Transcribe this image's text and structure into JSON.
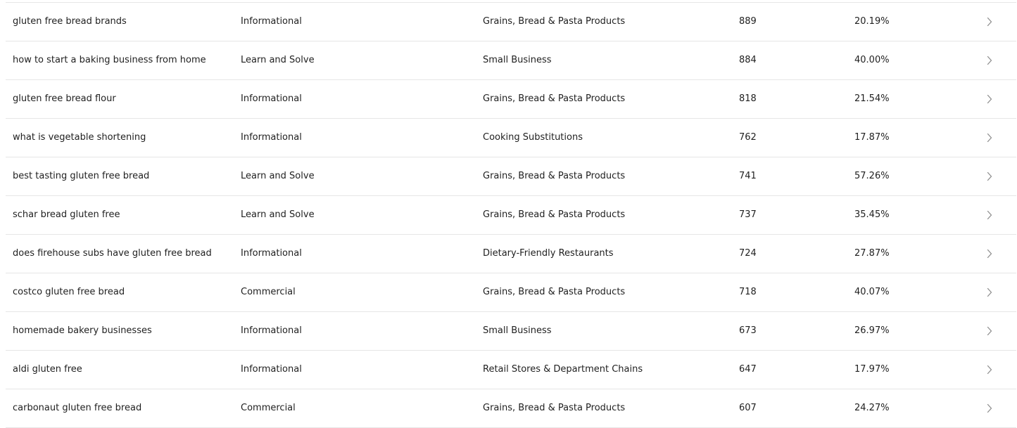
{
  "table": {
    "rows": [
      {
        "keyword": "gluten free bread brands",
        "intent": "Informational",
        "category": "Grains, Bread & Pasta Products",
        "volume": "889",
        "rate": "20.19%"
      },
      {
        "keyword": "how to start a baking business from home",
        "intent": "Learn and Solve",
        "category": "Small Business",
        "volume": "884",
        "rate": "40.00%"
      },
      {
        "keyword": "gluten free bread flour",
        "intent": "Informational",
        "category": "Grains, Bread & Pasta Products",
        "volume": "818",
        "rate": "21.54%"
      },
      {
        "keyword": "what is vegetable shortening",
        "intent": "Informational",
        "category": "Cooking Substitutions",
        "volume": "762",
        "rate": "17.87%"
      },
      {
        "keyword": "best tasting gluten free bread",
        "intent": "Learn and Solve",
        "category": "Grains, Bread & Pasta Products",
        "volume": "741",
        "rate": "57.26%"
      },
      {
        "keyword": "schar bread gluten free",
        "intent": "Learn and Solve",
        "category": "Grains, Bread & Pasta Products",
        "volume": "737",
        "rate": "35.45%"
      },
      {
        "keyword": "does firehouse subs have gluten free bread",
        "intent": "Informational",
        "category": "Dietary-Friendly Restaurants",
        "volume": "724",
        "rate": "27.87%"
      },
      {
        "keyword": "costco gluten free bread",
        "intent": "Commercial",
        "category": "Grains, Bread & Pasta Products",
        "volume": "718",
        "rate": "40.07%"
      },
      {
        "keyword": "homemade bakery businesses",
        "intent": "Informational",
        "category": "Small Business",
        "volume": "673",
        "rate": "26.97%"
      },
      {
        "keyword": "aldi gluten free",
        "intent": "Informational",
        "category": "Retail Stores & Department Chains",
        "volume": "647",
        "rate": "17.97%"
      },
      {
        "keyword": "carbonaut gluten free bread",
        "intent": "Commercial",
        "category": "Grains, Bread & Pasta Products",
        "volume": "607",
        "rate": "24.27%"
      }
    ],
    "row_icon": "chevron-right-icon"
  },
  "colors": {
    "text": "#1f1f1f",
    "divider": "#e6e6e6",
    "chevron": "#8a8a8a"
  }
}
